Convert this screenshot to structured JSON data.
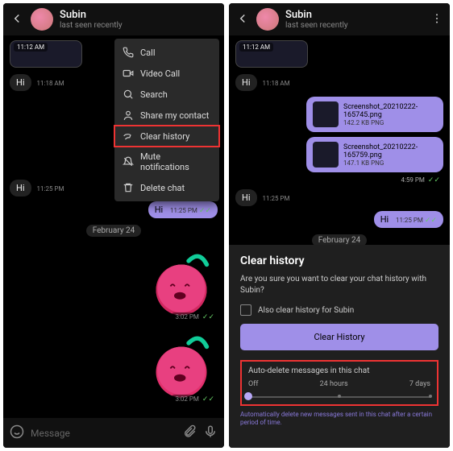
{
  "header": {
    "name": "Subin",
    "status": "last seen recently"
  },
  "menu": {
    "items": [
      {
        "label": "Call"
      },
      {
        "label": "Video Call"
      },
      {
        "label": "Search"
      },
      {
        "label": "Share my contact"
      },
      {
        "label": "Clear history"
      },
      {
        "label": "Mute notifications"
      },
      {
        "label": "Delete chat"
      }
    ]
  },
  "left": {
    "media_time": "11:12 AM",
    "msg1": "Hi",
    "msg1_time": "11:18 AM",
    "msg2": "Hi",
    "msg2_time": "11:25 PM",
    "out1": "Hi",
    "out1_time": "11:25 PM",
    "date": "February 24",
    "sticker_time1": "3:02 PM",
    "sticker_time2": "3:02 PM",
    "input_placeholder": "Message"
  },
  "right": {
    "media_time": "11:12 AM",
    "msg1": "Hi",
    "msg1_time": "11:18 AM",
    "file1_name": "Screenshot_20210222-165745.png",
    "file1_size": "142.2 KB PNG",
    "file2_name": "Screenshot_20210222-165759.png",
    "file2_size": "147.1 KB PNG",
    "files_time": "4:59 PM",
    "msg2": "Hi",
    "msg2_time": "11:25 PM",
    "out1": "Hi",
    "out1_time": "11:25 PM",
    "date": "February 24"
  },
  "dialog": {
    "title": "Clear history",
    "text": "Are you sure you want to clear your chat history with Subin?",
    "checkbox": "Also clear history for Subin",
    "button": "Clear History",
    "auto_title": "Auto-delete messages in this chat",
    "slider": {
      "off": "Off",
      "mid": "24 hours",
      "end": "7 days"
    },
    "desc": "Automatically delete new messages sent in this chat after a certain period of time."
  }
}
